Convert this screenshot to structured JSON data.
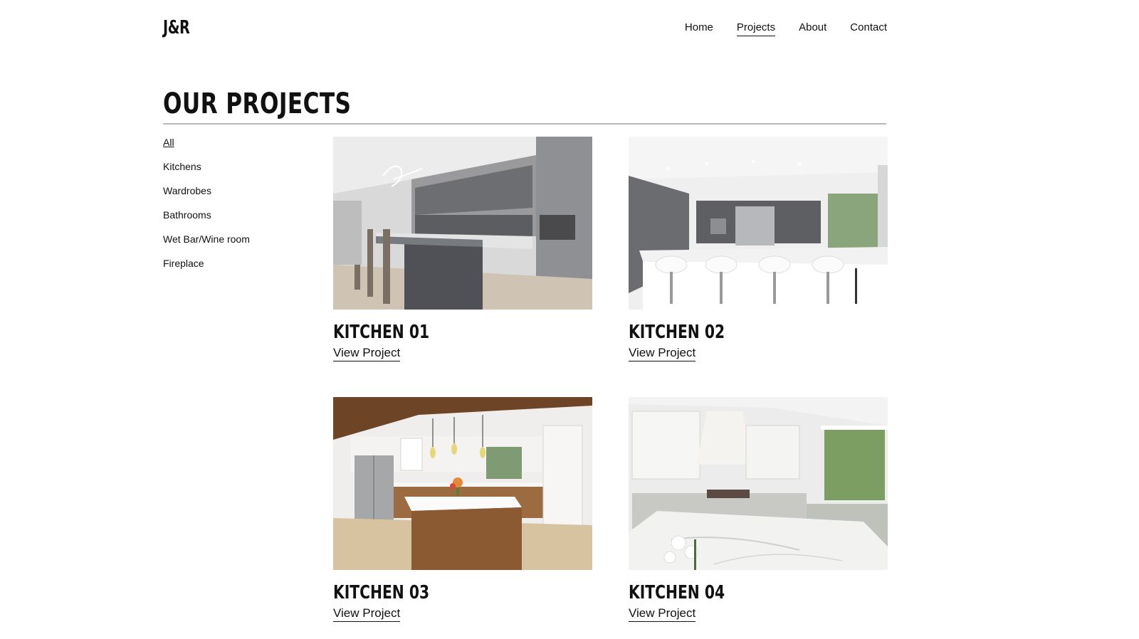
{
  "brand": {
    "logo_text": "J&R"
  },
  "nav": {
    "items": [
      {
        "label": "Home",
        "active": false
      },
      {
        "label": "Projects",
        "active": true
      },
      {
        "label": "About",
        "active": false
      },
      {
        "label": "Contact",
        "active": false
      }
    ]
  },
  "page": {
    "title": "OUR PROJECTS"
  },
  "filters": {
    "items": [
      {
        "label": "All",
        "active": true
      },
      {
        "label": "Kitchens",
        "active": false
      },
      {
        "label": "Wardrobes",
        "active": false
      },
      {
        "label": "Bathrooms",
        "active": false
      },
      {
        "label": "Wet Bar/Wine room",
        "active": false
      },
      {
        "label": "Fireplace",
        "active": false
      }
    ]
  },
  "projects": [
    {
      "title": "KITCHEN 01",
      "link_label": "View Project"
    },
    {
      "title": "KITCHEN 02",
      "link_label": "View Project"
    },
    {
      "title": "KITCHEN 03",
      "link_label": "View Project"
    },
    {
      "title": "KITCHEN 04",
      "link_label": "View Project"
    }
  ],
  "colors": {
    "text": "#111111",
    "rule": "#b9b9b9",
    "background": "#ffffff"
  }
}
